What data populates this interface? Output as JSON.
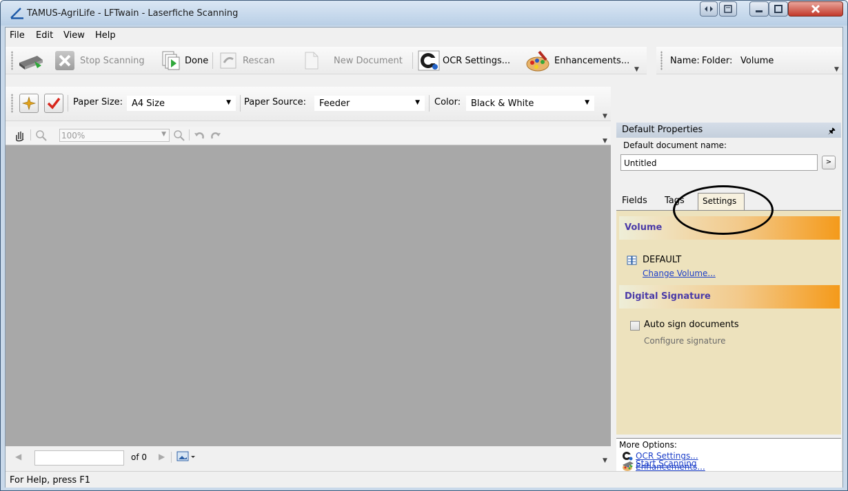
{
  "window": {
    "title": "TAMUS-AgriLife - LFTwain - Laserfiche Scanning"
  },
  "menu": [
    "File",
    "Edit",
    "View",
    "Help"
  ],
  "toolbar1": {
    "stop_scanning": "Stop Scanning",
    "done": "Done",
    "rescan": "Rescan",
    "new_document": "New Document",
    "ocr_settings": "OCR Settings...",
    "enhancements": "Enhancements...",
    "name_label": "Name:",
    "folder_label": "Folder:",
    "volume_label": "Volume"
  },
  "toolbar2": {
    "paper_size_label": "Paper Size:",
    "paper_size_value": "A4 Size",
    "paper_source_label": "Paper Source:",
    "paper_source_value": "Feeder",
    "color_label": "Color:",
    "color_value": "Black & White"
  },
  "viewer": {
    "zoom": "100%",
    "page_of": "of 0"
  },
  "status": "For Help, press F1",
  "panel": {
    "title": "Default Properties",
    "pin_icon": "pin-icon",
    "default_name_label": "Default document name:",
    "default_name_value": "Untitled",
    "browse_label": ">",
    "tabs": [
      "Fields",
      "Tags",
      "Settings"
    ],
    "active_tab": "Settings",
    "volume_section": "Volume",
    "volume_name": "DEFAULT",
    "change_volume": "Change Volume...",
    "signature_section": "Digital Signature",
    "auto_sign": "Auto sign documents",
    "auto_sign_checked": false,
    "configure_signature": "Configure signature",
    "more_options_label": "More Options:",
    "more_options": [
      "OCR Settings...",
      "Enhancements...",
      "Start Scanning"
    ]
  },
  "colors": {
    "section_gradient_end": "#f49a1a",
    "section_title": "#4a3aa8",
    "link": "#1c3fc9",
    "viewer_bg": "#a8a8a8",
    "settings_bg": "#ede2bd"
  }
}
